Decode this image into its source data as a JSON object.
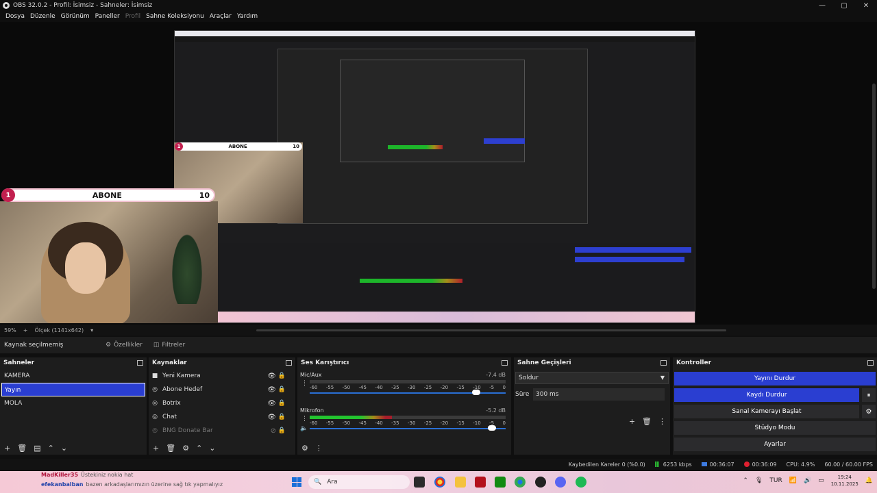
{
  "window": {
    "title": "OBS 32.0.2 - Profil: İsimsiz - Sahneler: İsimsiz",
    "min": "—",
    "max": "▢",
    "close": "✕"
  },
  "menu": {
    "file": "Dosya",
    "edit": "Düzenle",
    "view": "Görünüm",
    "docks": "Paneller",
    "profile": "Profil",
    "scene_collection": "Sahne Koleksiyonu",
    "tools": "Araçlar",
    "help": "Yardım"
  },
  "overlay": {
    "count": "1",
    "label": "ABONE",
    "goal": "10"
  },
  "preview_status": {
    "zoom": "59%",
    "plus": "+",
    "scale": "Ölçek (1141x642)"
  },
  "source_toolbar": {
    "no_source": "Kaynak seçilmemiş",
    "properties": "Özellikler",
    "filters": "Filtreler"
  },
  "scenes": {
    "title": "Sahneler",
    "items": [
      "KAMERA",
      "Yayın",
      "MOLA"
    ]
  },
  "sources": {
    "title": "Kaynaklar",
    "items": [
      {
        "label": "Yeni Kamera",
        "icon": "camera-icon"
      },
      {
        "label": "Abone Hedef",
        "icon": "browser-icon"
      },
      {
        "label": "Botrix",
        "icon": "browser-icon"
      },
      {
        "label": "Chat",
        "icon": "browser-icon"
      },
      {
        "label": "BNG Donate Bar",
        "icon": "browser-icon"
      }
    ]
  },
  "mixer": {
    "title": "Ses Karıştırıcı",
    "channels": [
      {
        "name": "Mic/Aux",
        "db": "-7.4 dB",
        "level": 0.0,
        "volume": 0.85
      },
      {
        "name": "Mikrofon",
        "db": "-5.2 dB",
        "level": 0.42,
        "volume": 0.93
      }
    ],
    "ticks": [
      "-60",
      "-55",
      "-50",
      "-45",
      "-40",
      "-35",
      "-30",
      "-25",
      "-20",
      "-15",
      "-10",
      "-5",
      "0"
    ]
  },
  "transitions": {
    "title": "Sahne Geçişleri",
    "selected": "Soldur",
    "duration_label": "Süre",
    "duration": "300 ms"
  },
  "controls": {
    "title": "Kontroller",
    "stop_stream": "Yayını Durdur",
    "stop_recording": "Kaydı Durdur",
    "virtual_camera": "Sanal Kamerayı Başlat",
    "studio_mode": "Stüdyo Modu",
    "settings": "Ayarlar"
  },
  "stats": {
    "dropped_frames": "Kaybedilen Kareler 0 (%0.0)",
    "bitrate": "6253 kbps",
    "stream_time": "00:36:07",
    "rec_time": "00:36:09",
    "cpu": "CPU: 4.9%",
    "fps": "60.00 / 60.00 FPS"
  },
  "chat": {
    "user1": "MadKiller35",
    "msg1": "Üstekiniz nokia hat",
    "user2": "efekanbalban",
    "msg2": "bazen arkadaşlarımızın üzerine sağ tık yapmalıyız"
  },
  "taskbar": {
    "search": "Ara",
    "lang": "TUR",
    "time": "19:24",
    "date": "10.11.2025"
  },
  "colors": {
    "accent": "#2a3ed1",
    "record": "#e02030",
    "meter_green": "#23c42f"
  }
}
